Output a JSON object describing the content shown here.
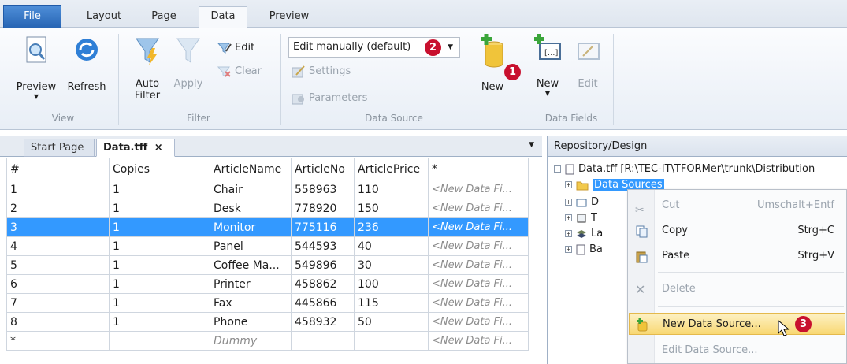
{
  "ribbon_tabs": [
    "File",
    "Layout",
    "Page",
    "Data",
    "Preview"
  ],
  "groups": {
    "view": {
      "label": "View",
      "preview": "Preview",
      "refresh": "Refresh"
    },
    "filter": {
      "label": "Filter",
      "auto_filter": "Auto Filter",
      "apply": "Apply",
      "edit": "Edit",
      "clear": "Clear"
    },
    "data_source": {
      "label": "Data Source",
      "combo": "Edit manually (default)",
      "settings": "Settings",
      "parameters": "Parameters",
      "new": "New"
    },
    "data_fields": {
      "label": "Data Fields",
      "new": "New",
      "edit": "Edit"
    }
  },
  "badges": {
    "one": "1",
    "two": "2",
    "three": "3"
  },
  "doc_tabs": {
    "start": "Start Page",
    "data": "Data.tff",
    "close": "×"
  },
  "grid": {
    "headers": [
      "#",
      "Copies",
      "ArticleName",
      "ArticleNo",
      "ArticlePrice",
      "*"
    ],
    "rows": [
      [
        "1",
        "1",
        "Chair",
        "558963",
        "110",
        "<New Data Fi..."
      ],
      [
        "2",
        "1",
        "Desk",
        "778920",
        "150",
        "<New Data Fi..."
      ],
      [
        "3",
        "1",
        "Monitor",
        "775116",
        "236",
        "<New Data Fi..."
      ],
      [
        "4",
        "1",
        "Panel",
        "544593",
        "40",
        "<New Data Fi..."
      ],
      [
        "5",
        "1",
        "Coffee Ma...",
        "549896",
        "30",
        "<New Data Fi..."
      ],
      [
        "6",
        "1",
        "Printer",
        "458862",
        "100",
        "<New Data Fi..."
      ],
      [
        "7",
        "1",
        "Fax",
        "445866",
        "115",
        "<New Data Fi..."
      ],
      [
        "8",
        "1",
        "Phone",
        "458932",
        "50",
        "<New Data Fi..."
      ],
      [
        "*",
        "",
        "Dummy",
        "",
        "",
        "<New Data Fi..."
      ]
    ],
    "selected_row": 3
  },
  "repository": {
    "title": "Repository/Design",
    "root": "Data.tff [R:\\TEC-IT\\TFORMer\\trunk\\Distribution",
    "items": [
      "Data Sources",
      "D",
      "T",
      "La",
      "Ba"
    ]
  },
  "context_menu": {
    "cut": {
      "label": "Cut",
      "shortcut": "Umschalt+Entf"
    },
    "copy": {
      "label": "Copy",
      "shortcut": "Strg+C"
    },
    "paste": {
      "label": "Paste",
      "shortcut": "Strg+V"
    },
    "delete": {
      "label": "Delete"
    },
    "new_ds": {
      "label": "New Data Source..."
    },
    "edit_ds": {
      "label": "Edit Data Source..."
    }
  },
  "colors": {
    "accent": "#3399ff",
    "badge": "#c8102e",
    "menu_highlight": "#f8d873"
  }
}
